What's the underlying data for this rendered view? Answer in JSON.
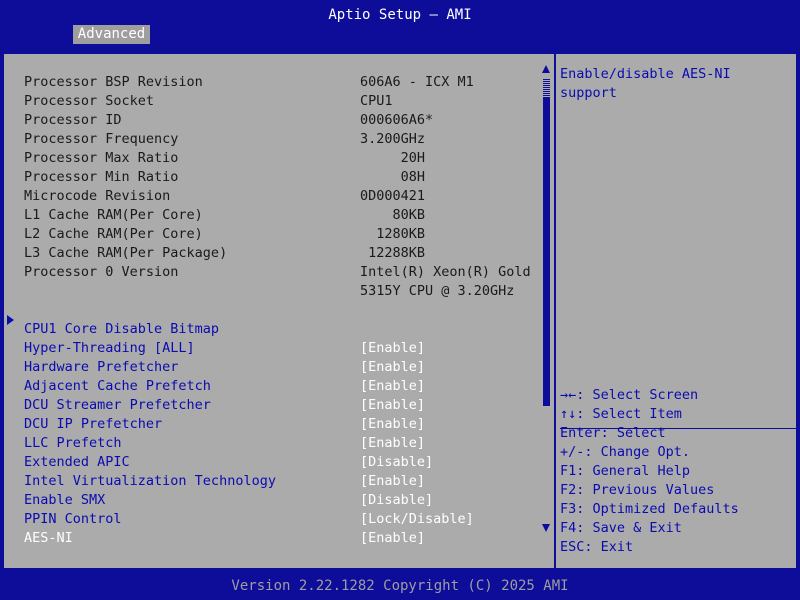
{
  "header": {
    "title": "Aptio Setup – AMI",
    "tab": "Advanced"
  },
  "info_rows": [
    {
      "label": "Processor BSP Revision",
      "value": "606A6 - ICX M1"
    },
    {
      "label": "Processor Socket",
      "value": "CPU1"
    },
    {
      "label": "Processor ID",
      "value": "000606A6*"
    },
    {
      "label": "Processor Frequency",
      "value": "3.200GHz"
    },
    {
      "label": "Processor Max Ratio",
      "value": "     20H"
    },
    {
      "label": "Processor Min Ratio",
      "value": "     08H"
    },
    {
      "label": "Microcode Revision",
      "value": "0D000421"
    },
    {
      "label": "L1 Cache RAM(Per Core)",
      "value": "    80KB"
    },
    {
      "label": "L2 Cache RAM(Per Core)",
      "value": "  1280KB"
    },
    {
      "label": "L3 Cache RAM(Per Package)",
      "value": " 12288KB"
    },
    {
      "label": "Processor 0 Version",
      "value": "Intel(R) Xeon(R) Gold"
    },
    {
      "label": "",
      "value": "5315Y CPU @ 3.20GHz"
    }
  ],
  "submenu": {
    "label": "CPU1 Core Disable Bitmap"
  },
  "settings": [
    {
      "label": "Hyper-Threading [ALL]",
      "value": "[Enable]"
    },
    {
      "label": "Hardware Prefetcher",
      "value": "[Enable]"
    },
    {
      "label": "Adjacent Cache Prefetch",
      "value": "[Enable]"
    },
    {
      "label": "DCU Streamer Prefetcher",
      "value": "[Enable]"
    },
    {
      "label": "DCU IP Prefetcher",
      "value": "[Enable]"
    },
    {
      "label": "LLC Prefetch",
      "value": "[Enable]"
    },
    {
      "label": "Extended APIC",
      "value": "[Disable]"
    },
    {
      "label": "Intel Virtualization Technology",
      "value": "[Enable]"
    },
    {
      "label": "Enable SMX",
      "value": "[Disable]"
    },
    {
      "label": "PPIN Control",
      "value": "[Lock/Disable]"
    },
    {
      "label": "AES-NI",
      "value": "[Enable]"
    }
  ],
  "selected_setting": "AES-NI",
  "help": {
    "text": "Enable/disable AES-NI support"
  },
  "keys": [
    "→←: Select Screen",
    "↑↓: Select Item",
    "Enter: Select",
    "+/-: Change Opt.",
    "F1: General Help",
    "F2: Previous Values",
    "F3: Optimized Defaults",
    "F4: Save & Exit",
    "ESC: Exit"
  ],
  "footer": {
    "text": "Version 2.22.1282 Copyright (C) 2025 AMI"
  },
  "colors": {
    "background": "#0d0d9a",
    "panel": "#ababab",
    "tab": "#9e9e9e",
    "highlight": "#ffffff",
    "setting_text": "#0b0bb0"
  }
}
